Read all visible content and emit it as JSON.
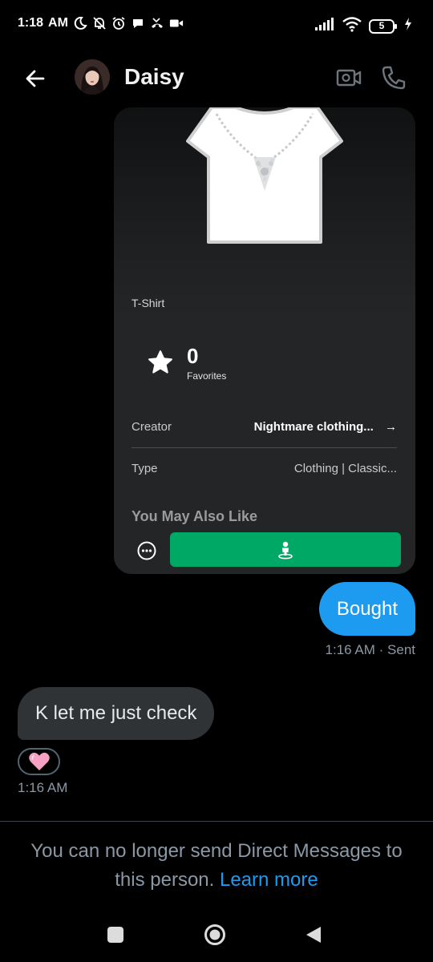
{
  "status_bar": {
    "time": "1:18",
    "ampm": "AM",
    "battery": "5",
    "icons": [
      "moon-icon",
      "bell-off-icon",
      "alarm-icon",
      "chat-bubble-icon",
      "missed-call-icon",
      "video-icon",
      "signal-icon",
      "wifi-icon",
      "battery-icon",
      "charging-icon"
    ]
  },
  "header": {
    "contact_name": "Daisy",
    "icons": [
      "back-arrow-icon",
      "video-call-icon",
      "phone-icon"
    ]
  },
  "shared_item": {
    "kind": "T-Shirt",
    "favorites_count": "0",
    "favorites_label": "Favorites",
    "creator_label": "Creator",
    "creator_value": "Nightmare clothing...",
    "creator_arrow": "→",
    "type_label": "Type",
    "type_value": "Clothing | Classic...",
    "also_like": "You May Also Like",
    "colors": {
      "try_on_button": "#00a865"
    }
  },
  "messages": [
    {
      "direction": "outgoing",
      "text": "Bought",
      "meta": "1:16 AM · Sent"
    },
    {
      "direction": "incoming",
      "text": "K let me just check",
      "reaction": "🩷",
      "meta": "1:16 AM"
    }
  ],
  "notice": {
    "text": "You can no longer send Direct Messages to this person.",
    "link": "Learn more"
  },
  "colors": {
    "accent": "#1d9bf0",
    "incoming_bubble": "#2f3336",
    "muted_text": "#8b98a5"
  }
}
